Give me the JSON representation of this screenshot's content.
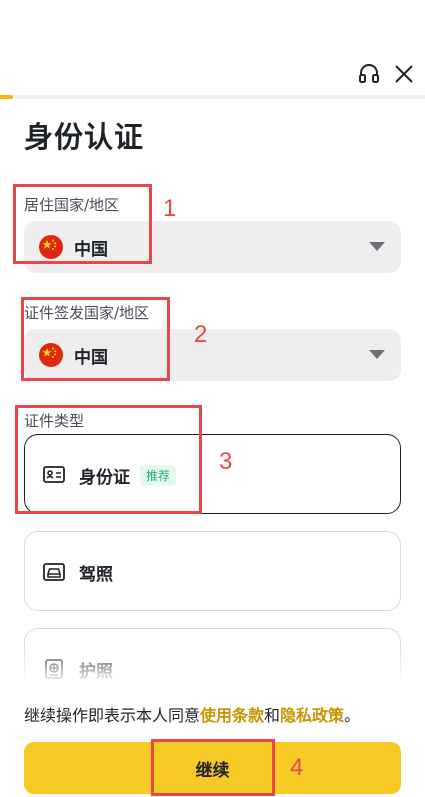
{
  "header": {
    "support_icon": "headset-icon",
    "close_icon": "close-icon",
    "progress_fraction": 0.03
  },
  "page": {
    "title": "身份认证"
  },
  "residence": {
    "label": "居住国家/地区",
    "value": "中国",
    "flag_icon": "china-flag-icon"
  },
  "issuing": {
    "label": "证件签发国家/地区",
    "value": "中国",
    "flag_icon": "china-flag-icon"
  },
  "doc_type": {
    "label": "证件类型",
    "options": [
      {
        "name": "身份证",
        "badge": "推荐",
        "icon": "id-card-icon",
        "selected": true
      },
      {
        "name": "驾照",
        "icon": "car-icon",
        "selected": false
      },
      {
        "name": "护照",
        "icon": "passport-icon",
        "selected": false
      }
    ]
  },
  "consent": {
    "prefix": "继续操作即表示本人同意",
    "terms_link": "使用条款",
    "middle": "和",
    "privacy_link": "隐私政策",
    "suffix": "。"
  },
  "continue_button": {
    "label": "继续"
  },
  "annotations": [
    "1",
    "2",
    "3",
    "4"
  ],
  "colors": {
    "accent": "#f0b90b",
    "button": "#f6c925",
    "link": "#c99400",
    "badge_text": "#20b26c",
    "annotation": "#e8474a"
  }
}
